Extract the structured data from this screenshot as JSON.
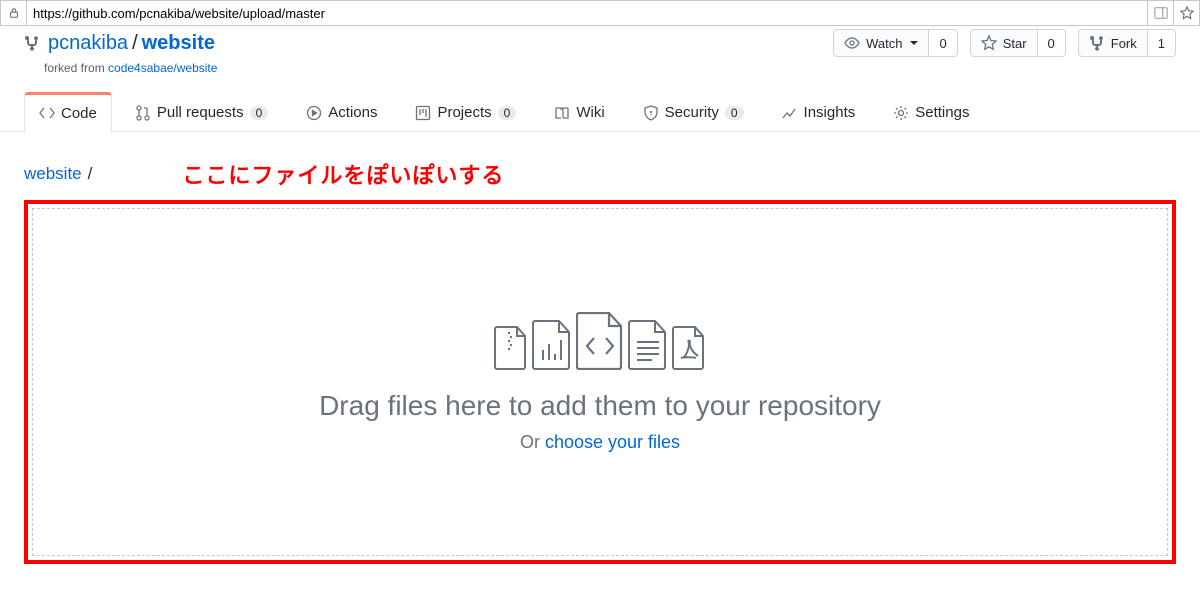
{
  "browser": {
    "url": "https://github.com/pcnakiba/website/upload/master"
  },
  "repo": {
    "owner": "pcnakiba",
    "name": "website",
    "forked_prefix": "forked from ",
    "forked_from": "code4sabae/website"
  },
  "actions": {
    "watch": {
      "label": "Watch",
      "count": "0"
    },
    "star": {
      "label": "Star",
      "count": "0"
    },
    "fork": {
      "label": "Fork",
      "count": "1"
    }
  },
  "tabs": {
    "code": "Code",
    "pulls": {
      "label": "Pull requests",
      "count": "0"
    },
    "actions": "Actions",
    "projects": {
      "label": "Projects",
      "count": "0"
    },
    "wiki": "Wiki",
    "security": {
      "label": "Security",
      "count": "0"
    },
    "insights": "Insights",
    "settings": "Settings"
  },
  "breadcrumb": {
    "root": "website",
    "sep": "/"
  },
  "annotation": "ここにファイルをぽいぽいする",
  "dropzone": {
    "title": "Drag files here to add them to your repository",
    "or": "Or ",
    "choose": "choose your files"
  }
}
